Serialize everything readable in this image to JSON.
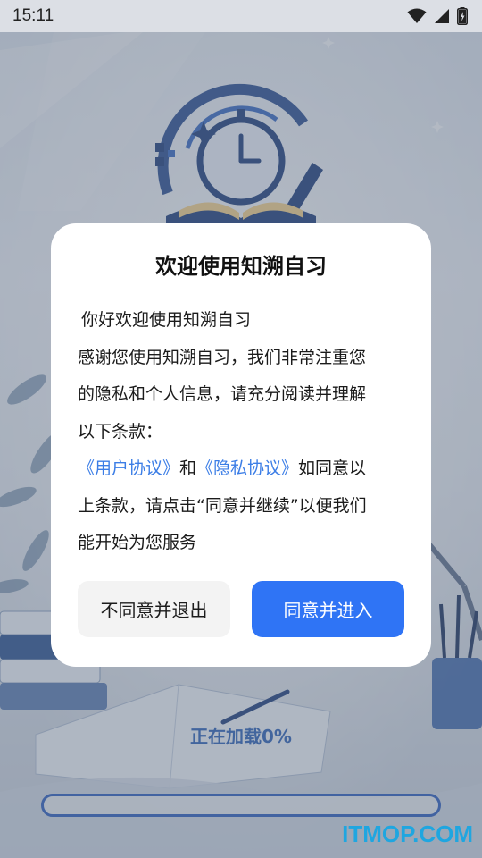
{
  "status_bar": {
    "time": "15:11",
    "icons": [
      "wifi-icon",
      "cellular-signal-icon",
      "battery-charging-icon"
    ]
  },
  "loading": {
    "text": "正在加载0%",
    "progress": 0
  },
  "dialog": {
    "title": "欢迎使用知溯自习",
    "greeting": "你好欢迎使用知溯自习",
    "body_lines": [
      "感谢您使用知溯自习，我们非常注重您",
      "的隐私和个人信息，请充分阅读并理解",
      "以下条款："
    ],
    "user_agreement_link": "《用户协议》",
    "conjunction": "和",
    "privacy_policy_link": "《隐私协议》",
    "consent_tail_1": "如同意以",
    "consent_line_2": "上条款，请点击“同意并继续”以便我们",
    "consent_line_3": "能开始为您服务",
    "decline_button": "不同意并退出",
    "accept_button": "同意并进入"
  },
  "watermark": "ITMOP.COM",
  "colors": {
    "accent": "#2f74f5",
    "link": "#3b7de6",
    "brand_blue": "#2e63b8"
  }
}
